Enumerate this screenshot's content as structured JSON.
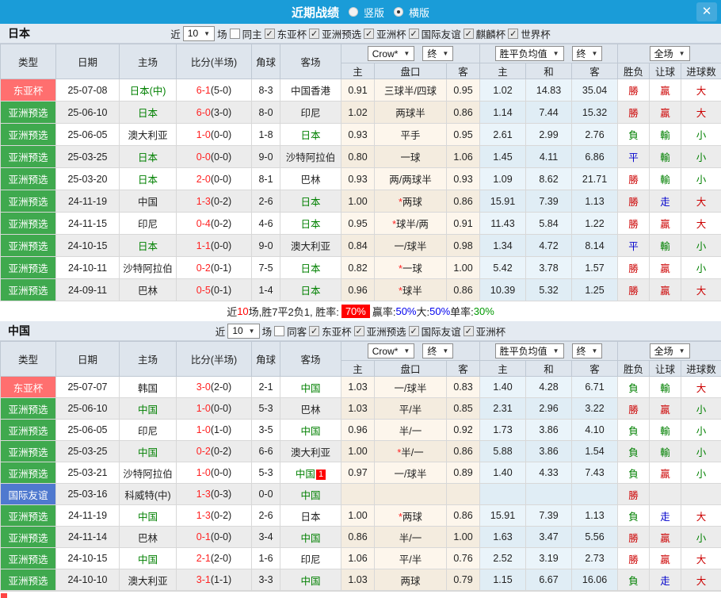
{
  "titlebar": {
    "title": "近期战绩",
    "vertical_label": "竖版",
    "horizontal_label": "横版",
    "close_icon": "✕"
  },
  "filter_labels": {
    "recent": "近",
    "count": "10",
    "matches": "场"
  },
  "table_header": {
    "type": "类型",
    "date": "日期",
    "home": "主场",
    "score": "比分(半场)",
    "corner": "角球",
    "away": "客场",
    "crow": "Crow*",
    "final": "终",
    "avg": "胜平负均值",
    "full": "全场",
    "h": "主",
    "handicap": "盘口",
    "a": "客",
    "draw": "和",
    "wl": "胜负",
    "let_goal": "让球",
    "goals": "进球数"
  },
  "colors": {
    "type": {
      "东亚杯": "#ff6f6f",
      "亚洲预选": "#3fa94e",
      "国际友谊": "#4f79cf"
    },
    "result": {
      "勝": "#cc0000",
      "負": "#008000",
      "平": "#0000cc",
      "贏": "#cc0000",
      "輸": "#008000",
      "走": "#0000cc",
      "大": "#cc0000",
      "小": "#008000"
    }
  },
  "japan": {
    "name": "日本",
    "same_venue_label": "同主",
    "same_checked": false,
    "cups": [
      "东亚杯",
      "亚洲预选",
      "亚洲杯",
      "国际友谊",
      "麒麟杯",
      "世界杯"
    ],
    "rows": [
      {
        "type": "东亚杯",
        "date": "25-07-08",
        "home": "日本(中)",
        "home_focus": true,
        "ft": "6-1",
        "ht": "(5-0)",
        "corner": "8-3",
        "away": "中国香港",
        "away_focus": false,
        "away_badge": "",
        "o_h": "0.91",
        "hcap": "三球半/四球",
        "o_a": "0.95",
        "a_h": "1.02",
        "a_d": "14.83",
        "a_a": "35.04",
        "r1": "勝",
        "r2": "贏",
        "r3": "大"
      },
      {
        "type": "亚洲预选",
        "date": "25-06-10",
        "home": "日本",
        "home_focus": true,
        "ft": "6-0",
        "ht": "(3-0)",
        "corner": "8-0",
        "away": "印尼",
        "away_focus": false,
        "away_badge": "",
        "o_h": "1.02",
        "hcap": "两球半",
        "o_a": "0.86",
        "a_h": "1.14",
        "a_d": "7.44",
        "a_a": "15.32",
        "r1": "勝",
        "r2": "贏",
        "r3": "大"
      },
      {
        "type": "亚洲预选",
        "date": "25-06-05",
        "home": "澳大利亚",
        "home_focus": false,
        "ft": "1-0",
        "ht": "(0-0)",
        "corner": "1-8",
        "away": "日本",
        "away_focus": true,
        "away_badge": "",
        "o_h": "0.93",
        "hcap": "平手",
        "o_a": "0.95",
        "a_h": "2.61",
        "a_d": "2.99",
        "a_a": "2.76",
        "r1": "負",
        "r2": "輸",
        "r3": "小"
      },
      {
        "type": "亚洲预选",
        "date": "25-03-25",
        "home": "日本",
        "home_focus": true,
        "ft": "0-0",
        "ht": "(0-0)",
        "corner": "9-0",
        "away": "沙特阿拉伯",
        "away_focus": false,
        "away_badge": "",
        "o_h": "0.80",
        "hcap": "一球",
        "o_a": "1.06",
        "a_h": "1.45",
        "a_d": "4.11",
        "a_a": "6.86",
        "r1": "平",
        "r2": "輸",
        "r3": "小"
      },
      {
        "type": "亚洲预选",
        "date": "25-03-20",
        "home": "日本",
        "home_focus": true,
        "ft": "2-0",
        "ht": "(0-0)",
        "corner": "8-1",
        "away": "巴林",
        "away_focus": false,
        "away_badge": "",
        "o_h": "0.93",
        "hcap": "两/两球半",
        "o_a": "0.93",
        "a_h": "1.09",
        "a_d": "8.62",
        "a_a": "21.71",
        "r1": "勝",
        "r2": "輸",
        "r3": "小"
      },
      {
        "type": "亚洲预选",
        "date": "24-11-19",
        "home": "中国",
        "home_focus": false,
        "ft": "1-3",
        "ht": "(0-2)",
        "corner": "2-6",
        "away": "日本",
        "away_focus": true,
        "away_badge": "",
        "o_h": "1.00",
        "hcap": "*两球",
        "o_a": "0.86",
        "a_h": "15.91",
        "a_d": "7.39",
        "a_a": "1.13",
        "r1": "勝",
        "r2": "走",
        "r3": "大"
      },
      {
        "type": "亚洲预选",
        "date": "24-11-15",
        "home": "印尼",
        "home_focus": false,
        "ft": "0-4",
        "ht": "(0-2)",
        "corner": "4-6",
        "away": "日本",
        "away_focus": true,
        "away_badge": "",
        "o_h": "0.95",
        "hcap": "*球半/两",
        "o_a": "0.91",
        "a_h": "11.43",
        "a_d": "5.84",
        "a_a": "1.22",
        "r1": "勝",
        "r2": "贏",
        "r3": "大"
      },
      {
        "type": "亚洲预选",
        "date": "24-10-15",
        "home": "日本",
        "home_focus": true,
        "ft": "1-1",
        "ht": "(0-0)",
        "corner": "9-0",
        "away": "澳大利亚",
        "away_focus": false,
        "away_badge": "",
        "o_h": "0.84",
        "hcap": "一/球半",
        "o_a": "0.98",
        "a_h": "1.34",
        "a_d": "4.72",
        "a_a": "8.14",
        "r1": "平",
        "r2": "輸",
        "r3": "小"
      },
      {
        "type": "亚洲预选",
        "date": "24-10-11",
        "home": "沙特阿拉伯",
        "home_focus": false,
        "ft": "0-2",
        "ht": "(0-1)",
        "corner": "7-5",
        "away": "日本",
        "away_focus": true,
        "away_badge": "",
        "o_h": "0.82",
        "hcap": "*一球",
        "o_a": "1.00",
        "a_h": "5.42",
        "a_d": "3.78",
        "a_a": "1.57",
        "r1": "勝",
        "r2": "贏",
        "r3": "小"
      },
      {
        "type": "亚洲预选",
        "date": "24-09-11",
        "home": "巴林",
        "home_focus": false,
        "ft": "0-5",
        "ht": "(0-1)",
        "corner": "1-4",
        "away": "日本",
        "away_focus": true,
        "away_badge": "",
        "o_h": "0.96",
        "hcap": "*球半",
        "o_a": "0.86",
        "a_h": "10.39",
        "a_d": "5.32",
        "a_a": "1.25",
        "r1": "勝",
        "r2": "贏",
        "r3": "大"
      }
    ],
    "summary": [
      {
        "text": "近",
        "style": "plain"
      },
      {
        "text": "10",
        "style": "red"
      },
      {
        "text": "场,胜7平2负1, 胜率:",
        "style": "plain"
      },
      {
        "text": "70%",
        "style": "redbox"
      },
      {
        "text": " 贏率:",
        "style": "plain"
      },
      {
        "text": "50%",
        "style": "blue"
      },
      {
        "text": " 大:",
        "style": "plain"
      },
      {
        "text": "50%",
        "style": "blue"
      },
      {
        "text": " 单率:",
        "style": "plain"
      },
      {
        "text": "30%",
        "style": "green"
      }
    ]
  },
  "china": {
    "name": "中国",
    "same_venue_label": "同客",
    "same_checked": false,
    "cups": [
      "东亚杯",
      "亚洲预选",
      "国际友谊",
      "亚洲杯"
    ],
    "rows": [
      {
        "type": "东亚杯",
        "date": "25-07-07",
        "home": "韩国",
        "home_focus": false,
        "ft": "3-0",
        "ht": "(2-0)",
        "corner": "2-1",
        "away": "中国",
        "away_focus": true,
        "away_badge": "",
        "o_h": "1.03",
        "hcap": "一/球半",
        "o_a": "0.83",
        "a_h": "1.40",
        "a_d": "4.28",
        "a_a": "6.71",
        "r1": "負",
        "r2": "輸",
        "r3": "大"
      },
      {
        "type": "亚洲预选",
        "date": "25-06-10",
        "home": "中国",
        "home_focus": true,
        "ft": "1-0",
        "ht": "(0-0)",
        "corner": "5-3",
        "away": "巴林",
        "away_focus": false,
        "away_badge": "",
        "o_h": "1.03",
        "hcap": "平/半",
        "o_a": "0.85",
        "a_h": "2.31",
        "a_d": "2.96",
        "a_a": "3.22",
        "r1": "勝",
        "r2": "贏",
        "r3": "小"
      },
      {
        "type": "亚洲预选",
        "date": "25-06-05",
        "home": "印尼",
        "home_focus": false,
        "ft": "1-0",
        "ht": "(1-0)",
        "corner": "3-5",
        "away": "中国",
        "away_focus": true,
        "away_badge": "",
        "o_h": "0.96",
        "hcap": "半/一",
        "o_a": "0.92",
        "a_h": "1.73",
        "a_d": "3.86",
        "a_a": "4.10",
        "r1": "負",
        "r2": "輸",
        "r3": "小"
      },
      {
        "type": "亚洲预选",
        "date": "25-03-25",
        "home": "中国",
        "home_focus": true,
        "ft": "0-2",
        "ht": "(0-2)",
        "corner": "6-6",
        "away": "澳大利亚",
        "away_focus": false,
        "away_badge": "",
        "o_h": "1.00",
        "hcap": "*半/一",
        "o_a": "0.86",
        "a_h": "5.88",
        "a_d": "3.86",
        "a_a": "1.54",
        "r1": "負",
        "r2": "輸",
        "r3": "小"
      },
      {
        "type": "亚洲预选",
        "date": "25-03-21",
        "home": "沙特阿拉伯",
        "home_focus": false,
        "ft": "1-0",
        "ht": "(0-0)",
        "corner": "5-3",
        "away": "中国",
        "away_focus": true,
        "away_badge": "1",
        "o_h": "0.97",
        "hcap": "一/球半",
        "o_a": "0.89",
        "a_h": "1.40",
        "a_d": "4.33",
        "a_a": "7.43",
        "r1": "負",
        "r2": "贏",
        "r3": "小"
      },
      {
        "type": "国际友谊",
        "date": "25-03-16",
        "home": "科威特(中)",
        "home_focus": false,
        "ft": "1-3",
        "ht": "(0-3)",
        "corner": "0-0",
        "away": "中国",
        "away_focus": true,
        "away_badge": "",
        "o_h": "",
        "hcap": "",
        "o_a": "",
        "a_h": "",
        "a_d": "",
        "a_a": "",
        "r1": "勝",
        "r2": "",
        "r3": ""
      },
      {
        "type": "亚洲预选",
        "date": "24-11-19",
        "home": "中国",
        "home_focus": true,
        "ft": "1-3",
        "ht": "(0-2)",
        "corner": "2-6",
        "away": "日本",
        "away_focus": false,
        "away_badge": "",
        "o_h": "1.00",
        "hcap": "*两球",
        "o_a": "0.86",
        "a_h": "15.91",
        "a_d": "7.39",
        "a_a": "1.13",
        "r1": "負",
        "r2": "走",
        "r3": "大"
      },
      {
        "type": "亚洲预选",
        "date": "24-11-14",
        "home": "巴林",
        "home_focus": false,
        "ft": "0-1",
        "ht": "(0-0)",
        "corner": "3-4",
        "away": "中国",
        "away_focus": true,
        "away_badge": "",
        "o_h": "0.86",
        "hcap": "半/一",
        "o_a": "1.00",
        "a_h": "1.63",
        "a_d": "3.47",
        "a_a": "5.56",
        "r1": "勝",
        "r2": "贏",
        "r3": "小"
      },
      {
        "type": "亚洲预选",
        "date": "24-10-15",
        "home": "中国",
        "home_focus": true,
        "ft": "2-1",
        "ht": "(2-0)",
        "corner": "1-6",
        "away": "印尼",
        "away_focus": false,
        "away_badge": "",
        "o_h": "1.06",
        "hcap": "平/半",
        "o_a": "0.76",
        "a_h": "2.52",
        "a_d": "3.19",
        "a_a": "2.73",
        "r1": "勝",
        "r2": "贏",
        "r3": "大"
      },
      {
        "type": "亚洲预选",
        "date": "24-10-10",
        "home": "澳大利亚",
        "home_focus": false,
        "ft": "3-1",
        "ht": "(1-1)",
        "corner": "3-3",
        "away": "中国",
        "away_focus": true,
        "away_badge": "",
        "o_h": "1.03",
        "hcap": "两球",
        "o_a": "0.79",
        "a_h": "1.15",
        "a_d": "6.67",
        "a_a": "16.06",
        "r1": "負",
        "r2": "走",
        "r3": "大"
      }
    ]
  }
}
